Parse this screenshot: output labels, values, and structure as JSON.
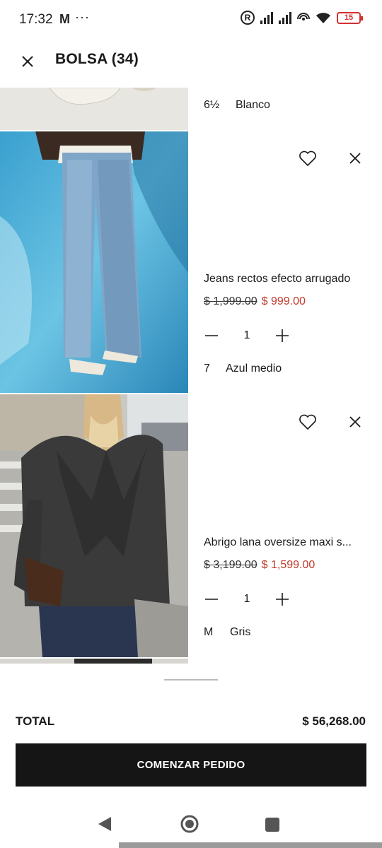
{
  "status_bar": {
    "time": "17:32",
    "carrier_icon": "M",
    "more": "···",
    "r_badge": "R",
    "battery": "15"
  },
  "header": {
    "close_icon": "close-icon",
    "title": "BOLSA (34)"
  },
  "items": [
    {
      "name": "",
      "size": "6½",
      "color": "Blanco",
      "thumb": "white-sneakers-photo"
    },
    {
      "name": "Jeans rectos efecto arrugado",
      "price_old": "$ 1,999.00",
      "price_new": "$ 999.00",
      "quantity": "1",
      "size": "7",
      "color": "Azul medio",
      "thumb": "blue-jeans-photo"
    },
    {
      "name": "Abrigo lana oversize maxi s...",
      "price_old": "$ 3,199.00",
      "price_new": "$ 1,599.00",
      "quantity": "1",
      "size": "M",
      "color": "Gris",
      "thumb": "grey-coat-photo"
    }
  ],
  "footer": {
    "total_label": "TOTAL",
    "total_value": "$ 56,268.00",
    "checkout_label": "COMENZAR PEDIDO"
  },
  "colors": {
    "accent_dark": "#151515",
    "sale_red": "#c0392b",
    "battery_red": "#d32f2f"
  }
}
